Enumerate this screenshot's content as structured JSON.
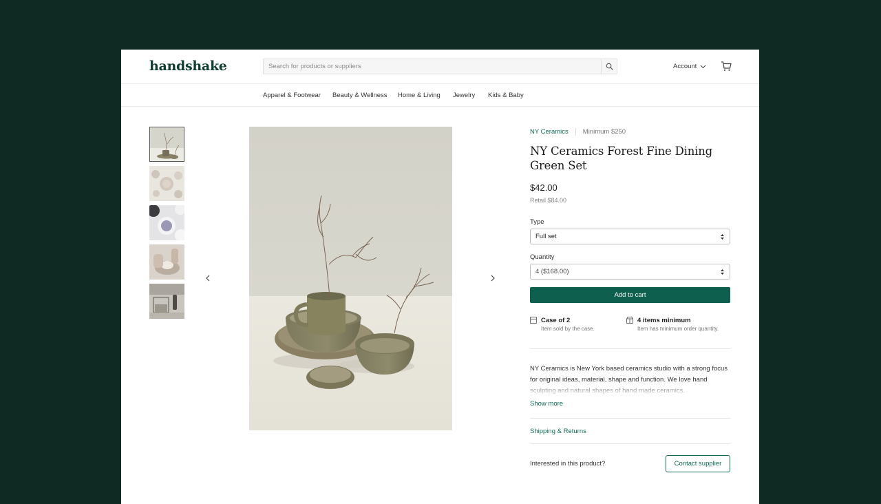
{
  "brand": {
    "logo_text": "handshake"
  },
  "search": {
    "placeholder": "Search for products or suppliers"
  },
  "header": {
    "account_label": "Account"
  },
  "nav": {
    "items": [
      {
        "label": "Apparel & Footwear"
      },
      {
        "label": "Beauty & Wellness"
      },
      {
        "label": "Home & Living"
      },
      {
        "label": "Jewelry"
      },
      {
        "label": "Kids & Baby"
      }
    ]
  },
  "product": {
    "supplier": "NY Ceramics",
    "minimum": "Minimum $250",
    "title": "NY Ceramics Forest Fine Dining Green Set",
    "price": "$42.00",
    "retail": "Retail $84.00",
    "type_label": "Type",
    "type_value": "Full set",
    "quantity_label": "Quantity",
    "quantity_value": "4 ($168.00)",
    "add_to_cart": "Add to cart",
    "info": [
      {
        "title": "Case of 2",
        "subtitle": "Item sold by the case.",
        "icon": "box-icon"
      },
      {
        "title": "4 items minimum",
        "subtitle": "Item has minimum order quantity.",
        "icon": "store-icon"
      }
    ],
    "description": "NY Ceramics is New York based ceramics studio with a strong focus for original ideas, material, shape and function. We love hand sculpting and natural shapes of hand made ceramics.",
    "show_more": "Show more",
    "shipping_returns": "Shipping & Returns",
    "interested": "Interested in this product?",
    "contact_supplier": "Contact supplier"
  },
  "colors": {
    "page_background": "#0e2a22",
    "brand_green": "#0f5f4e",
    "link_green": "#0f6a55"
  }
}
